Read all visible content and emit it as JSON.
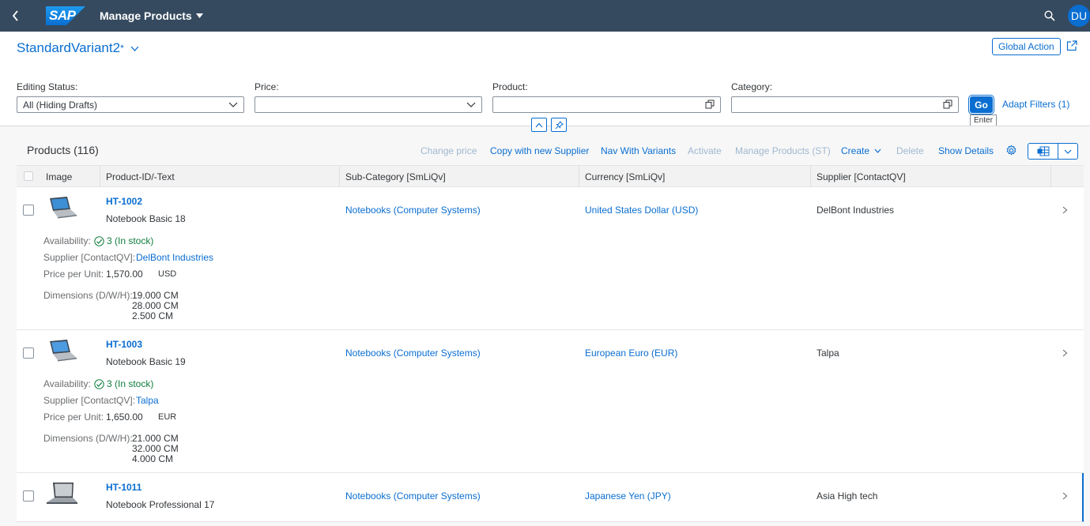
{
  "shell": {
    "app_title": "Manage Products",
    "logo_text": "SAP",
    "avatar": "DU"
  },
  "header": {
    "variant": "StandardVariant2",
    "variant_modified": "*",
    "global_action": "Global Action"
  },
  "filters": {
    "editing_status": {
      "label": "Editing Status:",
      "value": "All (Hiding Drafts)"
    },
    "price": {
      "label": "Price:",
      "value": ""
    },
    "product": {
      "label": "Product:",
      "value": ""
    },
    "category": {
      "label": "Category:",
      "value": ""
    },
    "go": "Go",
    "go_tooltip": "Enter",
    "adapt_filters": "Adapt Filters (1)"
  },
  "table": {
    "title": "Products (116)",
    "toolbar": {
      "change_price": "Change price",
      "copy_supplier": "Copy with new Supplier",
      "nav_variants": "Nav With Variants",
      "activate": "Activate",
      "manage_products": "Manage Products (ST)",
      "create": "Create",
      "delete": "Delete",
      "show_details": "Show Details"
    },
    "columns": [
      "Image",
      "Product-ID/-Text",
      "Sub-Category [SmLiQv]",
      "Currency [SmLiQv]",
      "Supplier [ContactQV]"
    ],
    "labels": {
      "availability": "Availability:",
      "supplier": "Supplier [ContactQV]:",
      "price_per_unit": "Price per Unit:",
      "dimensions": "Dimensions (D/W/H):"
    },
    "rows": [
      {
        "id": "HT-1002",
        "name": "Notebook Basic 18",
        "subcategory": "Notebooks (Computer Systems)",
        "currency": "United States Dollar (USD)",
        "supplier": "DelBont Industries",
        "availability": "3 (In stock)",
        "price": "1,570.00",
        "unit": "USD",
        "dims": [
          "19.000 CM",
          "28.000 CM",
          "2.500 CM"
        ]
      },
      {
        "id": "HT-1003",
        "name": "Notebook Basic 19",
        "subcategory": "Notebooks (Computer Systems)",
        "currency": "European Euro (EUR)",
        "supplier": "Talpa",
        "availability": "3 (In stock)",
        "price": "1,650.00",
        "unit": "EUR",
        "dims": [
          "21.000 CM",
          "32.000 CM",
          "4.000 CM"
        ]
      },
      {
        "id": "HT-1011",
        "name": "Notebook Professional 17",
        "subcategory": "Notebooks (Computer Systems)",
        "currency": "Japanese Yen (JPY)",
        "supplier": "Asia High tech"
      }
    ]
  },
  "colors": {
    "shell": "#354a5f",
    "accent": "#0a6ed1",
    "positive": "#107e3e"
  }
}
